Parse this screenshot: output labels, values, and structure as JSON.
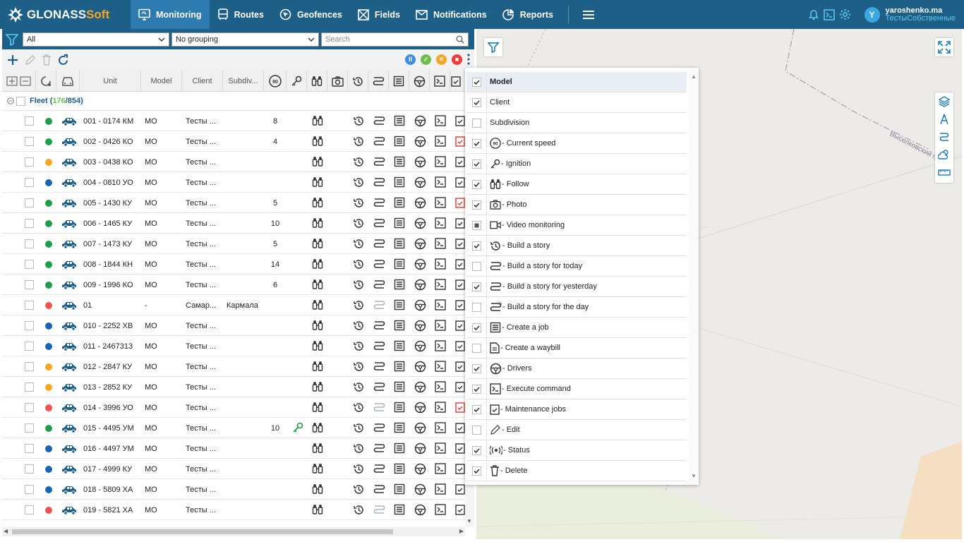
{
  "app": {
    "logo_a": "GLONASS",
    "logo_b": "Soft",
    "nav": [
      {
        "label": "Monitoring",
        "icon": "monitor-icon",
        "active": true
      },
      {
        "label": "Routes",
        "icon": "bus-icon"
      },
      {
        "label": "Geofences",
        "icon": "geofence-icon"
      },
      {
        "label": "Fields",
        "icon": "fields-icon"
      },
      {
        "label": "Notifications",
        "icon": "mail-icon"
      },
      {
        "label": "Reports",
        "icon": "pie-chart-icon"
      }
    ],
    "user_avatar": "Y",
    "user_name": "yaroshenko.ma",
    "user_org": "ТестыСобственные"
  },
  "filter": {
    "filter_value": "All",
    "grouping_value": "No grouping",
    "search_placeholder": "Search"
  },
  "columns": {
    "unit": "Unit",
    "model": "Model",
    "client": "Client",
    "subdivision": "Subdiv..."
  },
  "fleet": {
    "label": "Fleet",
    "online": "176",
    "separator": "/",
    "total": "854"
  },
  "rows": [
    {
      "status": "green",
      "unit": "001 - 0174 КМ",
      "model": "МО",
      "client": "Тесты ...",
      "sub": "",
      "speed": "8",
      "ignition": false,
      "alert": false
    },
    {
      "status": "green",
      "unit": "002 - 0426 КО",
      "model": "МО",
      "client": "Тесты ...",
      "sub": "",
      "speed": "4",
      "ignition": false,
      "alert": true
    },
    {
      "status": "orange",
      "unit": "003 - 0438 КО",
      "model": "МО",
      "client": "Тесты ...",
      "sub": "",
      "speed": "",
      "ignition": false,
      "alert": false
    },
    {
      "status": "blue",
      "unit": "004 - 0810 УО",
      "model": "МО",
      "client": "Тесты ...",
      "sub": "",
      "speed": "",
      "ignition": false,
      "alert": false
    },
    {
      "status": "green",
      "unit": "005 - 1430 КУ",
      "model": "МО",
      "client": "Тесты ...",
      "sub": "",
      "speed": "5",
      "ignition": false,
      "alert": true
    },
    {
      "status": "green",
      "unit": "006 - 1465 КУ",
      "model": "МО",
      "client": "Тесты ...",
      "sub": "",
      "speed": "10",
      "ignition": false,
      "alert": false
    },
    {
      "status": "green",
      "unit": "007 - 1473 КУ",
      "model": "МО",
      "client": "Тесты ...",
      "sub": "",
      "speed": "5",
      "ignition": false,
      "alert": false
    },
    {
      "status": "green",
      "unit": "008 - 1844 КН",
      "model": "МО",
      "client": "Тесты ...",
      "sub": "",
      "speed": "14",
      "ignition": false,
      "alert": false
    },
    {
      "status": "green",
      "unit": "009 - 1996 КО",
      "model": "МО",
      "client": "Тесты ...",
      "sub": "",
      "speed": "6",
      "ignition": false,
      "alert": false
    },
    {
      "status": "red",
      "unit": "01",
      "model": "-",
      "client": "Самар...",
      "sub": "Кармала",
      "speed": "",
      "ignition": false,
      "alert": false,
      "grey_story": true
    },
    {
      "status": "blue",
      "unit": "010 - 2252 ХВ",
      "model": "МО",
      "client": "Тесты ...",
      "sub": "",
      "speed": "",
      "ignition": false,
      "alert": false
    },
    {
      "status": "blue",
      "unit": "011 - 2467313",
      "model": "МО",
      "client": "Тесты ...",
      "sub": "",
      "speed": "",
      "ignition": false,
      "alert": false
    },
    {
      "status": "orange",
      "unit": "012 - 2847 КУ",
      "model": "МО",
      "client": "Тесты ...",
      "sub": "",
      "speed": "",
      "ignition": false,
      "alert": false
    },
    {
      "status": "orange",
      "unit": "013 - 2852 КУ",
      "model": "МО",
      "client": "Тесты ...",
      "sub": "",
      "speed": "",
      "ignition": false,
      "alert": false
    },
    {
      "status": "red",
      "unit": "014 - 3996 УО",
      "model": "МО",
      "client": "Тесты ...",
      "sub": "",
      "speed": "",
      "ignition": false,
      "alert": true,
      "grey_story": true
    },
    {
      "status": "green",
      "unit": "015 - 4495 УМ",
      "model": "МО",
      "client": "Тесты ...",
      "sub": "",
      "speed": "10",
      "ignition": true,
      "alert": false
    },
    {
      "status": "blue",
      "unit": "016 - 4497 УМ",
      "model": "МО",
      "client": "Тесты ...",
      "sub": "",
      "speed": "",
      "ignition": false,
      "alert": false
    },
    {
      "status": "blue",
      "unit": "017 - 4999 КУ",
      "model": "МО",
      "client": "Тесты ...",
      "sub": "",
      "speed": "",
      "ignition": false,
      "alert": false
    },
    {
      "status": "blue",
      "unit": "018 - 5809 ХА",
      "model": "МО",
      "client": "Тесты ...",
      "sub": "",
      "speed": "",
      "ignition": false,
      "alert": false
    },
    {
      "status": "red",
      "unit": "019 - 5821 ХА",
      "model": "МО",
      "client": "Тесты ...",
      "sub": "",
      "speed": "",
      "ignition": false,
      "alert": false,
      "grey_story": true
    }
  ],
  "column_menu": [
    {
      "label": "Model",
      "state": "checked",
      "icon": "",
      "bold": true
    },
    {
      "label": "Client",
      "state": "checked",
      "icon": ""
    },
    {
      "label": "Subdivision",
      "state": "unchecked",
      "icon": ""
    },
    {
      "label": "- Current speed",
      "state": "checked",
      "icon": "speed-icon"
    },
    {
      "label": "- Ignition",
      "state": "checked",
      "icon": "key-icon"
    },
    {
      "label": "- Follow",
      "state": "checked",
      "icon": "binoculars-icon"
    },
    {
      "label": "- Photo",
      "state": "checked",
      "icon": "camera-icon"
    },
    {
      "label": "- Video monitoring",
      "state": "partial",
      "icon": "video-icon"
    },
    {
      "label": "- Build a story",
      "state": "checked",
      "icon": "history-icon"
    },
    {
      "label": "- Build a story for today",
      "state": "unchecked",
      "icon": "route-icon"
    },
    {
      "label": "- Build a story for yesterday",
      "state": "checked",
      "icon": "route-icon"
    },
    {
      "label": "- Build a story for the day",
      "state": "unchecked",
      "icon": "route24-icon"
    },
    {
      "label": "- Create a job",
      "state": "checked",
      "icon": "job-icon"
    },
    {
      "label": "- Create a waybill",
      "state": "unchecked",
      "icon": "waybill-icon"
    },
    {
      "label": "- Drivers",
      "state": "checked",
      "icon": "steering-wheel-icon"
    },
    {
      "label": "- Execute command",
      "state": "checked",
      "icon": "terminal-icon"
    },
    {
      "label": "- Maintenance jobs",
      "state": "checked",
      "icon": "clipboard-check-icon"
    },
    {
      "label": "- Edit",
      "state": "unchecked",
      "icon": "pencil-icon"
    },
    {
      "label": "- Status",
      "state": "checked",
      "icon": "status-icon"
    },
    {
      "label": "- Delete",
      "state": "checked",
      "icon": "trash-icon"
    }
  ],
  "map": {
    "street_label": "Выселковский п"
  },
  "colors": {
    "brand": "#1d5f87",
    "accent": "#f5a623",
    "green": "#1e9e4a",
    "orange": "#f5a623",
    "blue": "#1a64b5",
    "red": "#ef5350"
  }
}
